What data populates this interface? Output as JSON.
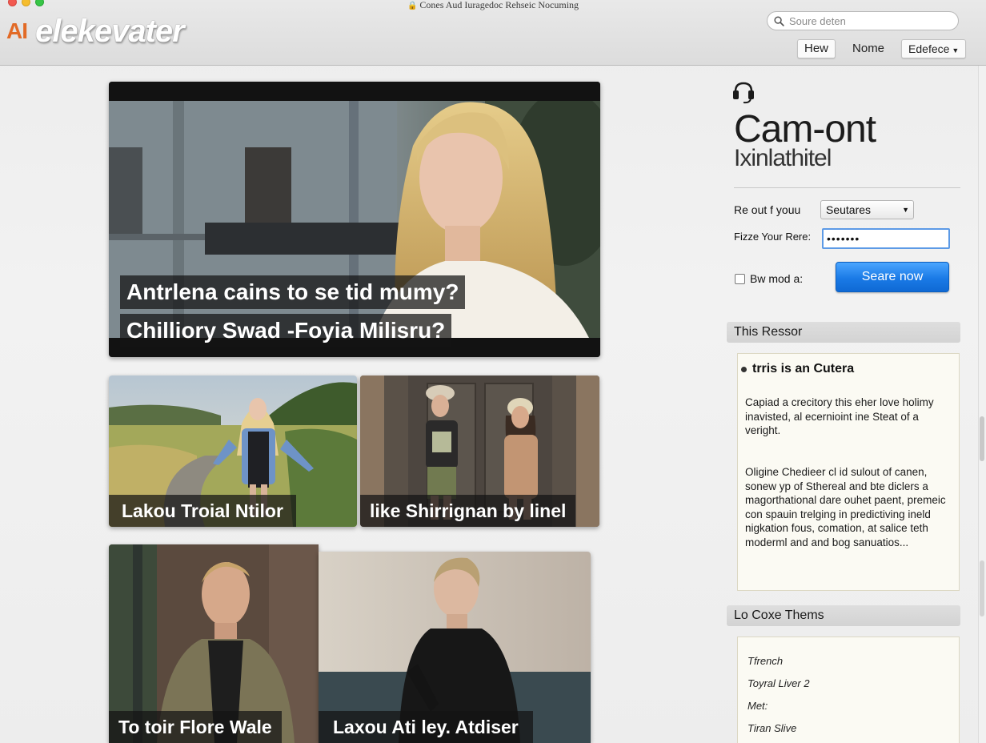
{
  "window": {
    "title": "Cones Aud Iuragedoc Rehseic Nocuming",
    "controls": [
      "close",
      "minimize",
      "zoom"
    ]
  },
  "header": {
    "logo_prefix": "AI",
    "logo_word": "elekevater",
    "search_placeholder": "Soure deten",
    "nav": [
      {
        "label": "Hew",
        "boxed": true
      },
      {
        "label": "Nome",
        "boxed": false
      },
      {
        "label": "Edefece",
        "boxed": true,
        "dropdown": true
      }
    ]
  },
  "tiles": {
    "hero": {
      "caption_line1": "Antrlena cains to se tid mumy?",
      "caption_line2": "Chilliory Swad -Foyia Milisru?"
    },
    "row2": [
      {
        "caption": "Lakou Troial Ntilor"
      },
      {
        "caption": "like Shirrignan by linel"
      }
    ],
    "row3": [
      {
        "caption": "To toir Flore Wale"
      },
      {
        "caption": "Laxou Ati ley. Atdiser"
      }
    ]
  },
  "sidebar": {
    "icon": "headphones-icon",
    "title": "Cam-ont",
    "subtitle": "Ixinlathitel",
    "form": {
      "result_label": "Re out f youu",
      "result_select_value": "Seutares",
      "password_label": "Fizze Your Rere:",
      "password_value": "•••••••",
      "checkbox_label": "Bw mod a:",
      "checkbox_checked": false,
      "submit_label": "Seare now"
    },
    "section1": {
      "header": "This Ressor",
      "item_title": "trris is an Cutera",
      "paragraph1": "Capiad a crecitory this eher love holimy inavisted, al ecernioint ine Steat of a veright.",
      "paragraph2": "Oligine Chedieer cl id sulout of canen, sonew yp of Sthereal and bte diclers a magorthational dare ouhet paent, premeic con spauin trelging in predictiving ineld nigkation fous, comation, at salice teth moderml and and bog sanuatios..."
    },
    "section2": {
      "header": "Lo Coxe Thems",
      "items": [
        "Tfrench",
        "Toyral Liver 2",
        "Met:",
        "Tiran Slive"
      ]
    }
  },
  "colors": {
    "accent_blue": "#1a7ae6",
    "logo_orange": "#e26a26",
    "panel_bg": "#fbfaf3"
  }
}
